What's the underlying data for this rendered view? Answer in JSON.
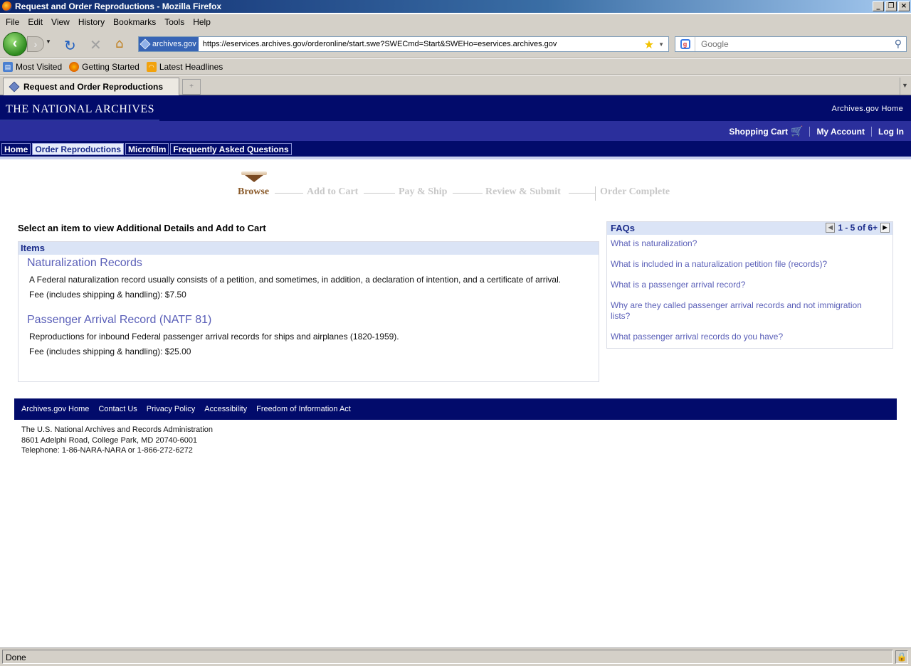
{
  "window": {
    "title": "Request and Order Reproductions - Mozilla Firefox"
  },
  "menubar": {
    "items": [
      {
        "label": "File",
        "key": "F"
      },
      {
        "label": "Edit",
        "key": "E"
      },
      {
        "label": "View",
        "key": "V"
      },
      {
        "label": "History",
        "key": "s"
      },
      {
        "label": "Bookmarks",
        "key": "B"
      },
      {
        "label": "Tools",
        "key": "T"
      },
      {
        "label": "Help",
        "key": "H"
      }
    ]
  },
  "navbar": {
    "site_identity": "archives.gov",
    "url": "https://eservices.archives.gov/orderonline/start.swe?SWECmd=Start&SWEHo=eservices.archives.gov",
    "search_placeholder": "Google"
  },
  "bookmarks": [
    {
      "label": "Most Visited",
      "icon": "most-visited-icon"
    },
    {
      "label": "Getting Started",
      "icon": "firefox-icon"
    },
    {
      "label": "Latest Headlines",
      "icon": "rss-icon"
    }
  ],
  "tab": {
    "title": "Request and Order Reproductions"
  },
  "site": {
    "brand": "THE NATIONAL ARCHIVES",
    "archives_home": "Archives.gov Home",
    "util": {
      "cart": "Shopping Cart",
      "account": "My Account",
      "login": "Log In"
    },
    "nav": [
      "Home",
      "Order Reproductions",
      "Microfilm",
      "Frequently Asked Questions"
    ],
    "nav_active_index": 1
  },
  "steps": [
    "Browse",
    "Add to Cart",
    "Pay & Ship",
    "Review & Submit",
    "Order Complete"
  ],
  "current_step": "Browse",
  "main": {
    "instructions": "Select an item to view Additional Details and Add to Cart",
    "items_header": "Items",
    "items": [
      {
        "title": "Naturalization Records",
        "description": "A Federal naturalization record usually consists of a petition, and sometimes, in addition, a declaration of intention, and a certificate of arrival.",
        "fee": "Fee (includes shipping & handling): $7.50"
      },
      {
        "title": "Passenger Arrival Record (NATF 81)",
        "description": "Reproductions for inbound Federal passenger arrival records for ships and airplanes (1820-1959).",
        "fee": "Fee (includes shipping & handling): $25.00"
      }
    ]
  },
  "faqs": {
    "title": "FAQs",
    "pager": "1 - 5 of 6+",
    "links": [
      "What is naturalization?",
      "What is included in a naturalization petition file (records)?",
      "What is a passenger arrival record?",
      "Why are they called passenger arrival records and not immigration lists?",
      "What passenger arrival records do you have?"
    ]
  },
  "footer": {
    "links": [
      "Archives.gov Home",
      "Contact Us",
      "Privacy Policy",
      "Accessibility",
      "Freedom of Information Act"
    ],
    "address": [
      "The U.S. National Archives and Records Administration",
      "8601 Adelphi Road, College Park, MD 20740-6001",
      "Telephone: 1-86-NARA-NARA or 1-866-272-6272"
    ]
  },
  "status": {
    "text": "Done"
  }
}
